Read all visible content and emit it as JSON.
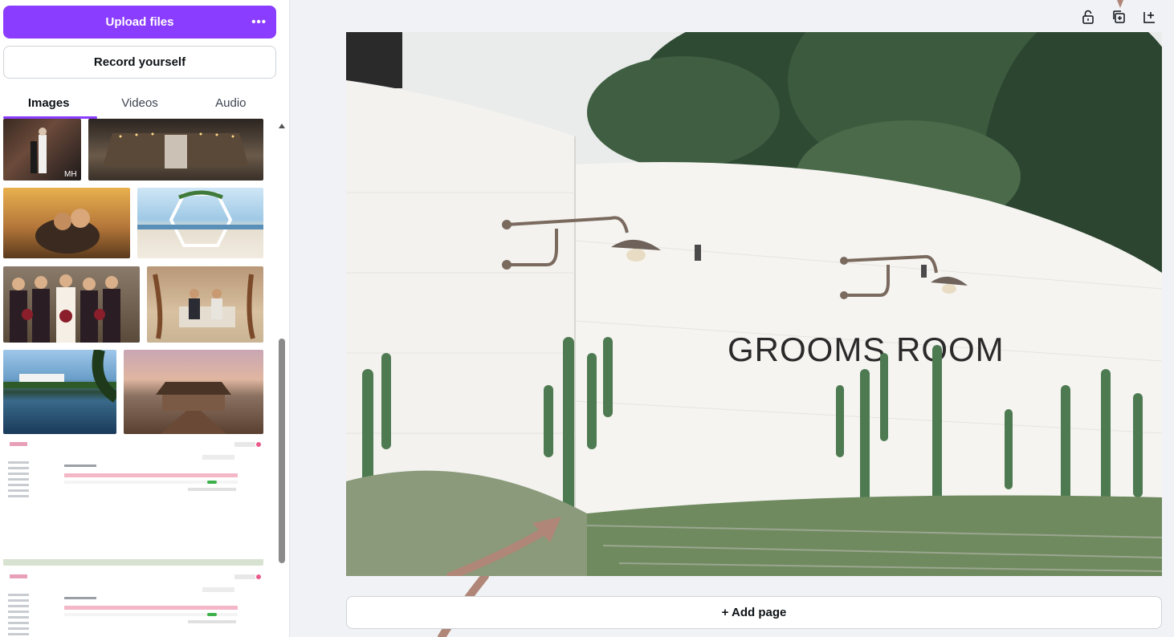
{
  "sidebar": {
    "upload_label": "Upload files",
    "more_label": "•••",
    "record_label": "Record yourself",
    "tabs": [
      {
        "label": "Images"
      },
      {
        "label": "Videos"
      },
      {
        "label": "Audio"
      }
    ],
    "active_tab": "Images"
  },
  "canvas": {
    "sign_text": "GROOMS ROOM",
    "add_page_label": "+ Add page"
  },
  "icons": {
    "lock": "lock-icon",
    "duplicate": "duplicate-page-icon",
    "add": "add-page-icon"
  },
  "colors": {
    "accent": "#8b3dff",
    "annotation_arrow": "#b08678"
  }
}
